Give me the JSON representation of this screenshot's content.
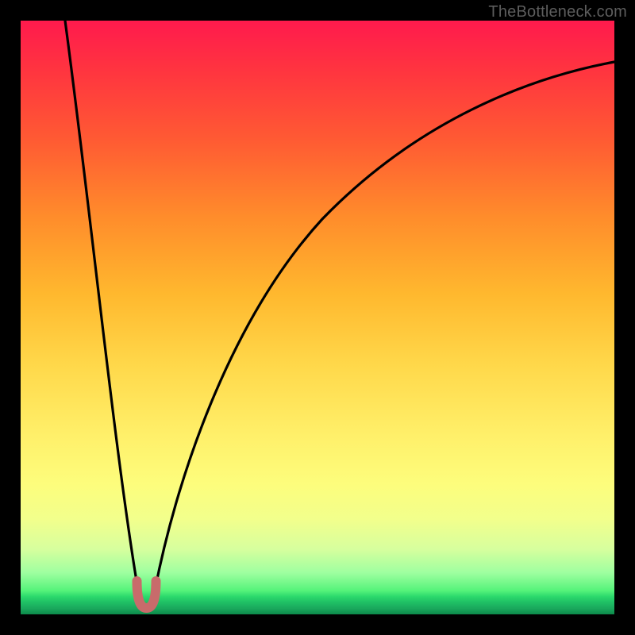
{
  "watermark": "TheBottleneck.com",
  "colors": {
    "page_bg": "#000000",
    "curve": "#000000",
    "marker_fill": "#c86b6b",
    "marker_stroke": "#b85e5e"
  },
  "chart_data": {
    "type": "line",
    "title": "",
    "xlabel": "",
    "ylabel": "",
    "xlim": [
      0,
      100
    ],
    "ylim": [
      0,
      100
    ],
    "grid": false,
    "legend": false,
    "series": [
      {
        "name": "left-branch",
        "x": [
          7.5,
          9,
          10.5,
          12,
          13.5,
          15,
          16.5,
          18,
          19.2,
          19.8
        ],
        "y": [
          100,
          89,
          78,
          66,
          54,
          42,
          30,
          18,
          8,
          4
        ]
      },
      {
        "name": "right-branch",
        "x": [
          22.6,
          23.5,
          25,
          27,
          30,
          34,
          38,
          43,
          49,
          56,
          64,
          73,
          83,
          92,
          100
        ],
        "y": [
          4,
          8,
          16,
          26,
          37,
          47,
          55,
          62,
          68,
          74,
          79,
          83,
          87,
          90.5,
          93
        ]
      }
    ],
    "markers": [
      {
        "name": "min-left",
        "x": 19.8,
        "y": 4
      },
      {
        "name": "min-mid",
        "x": 21.2,
        "y": 1.3
      },
      {
        "name": "min-right",
        "x": 22.6,
        "y": 4
      }
    ]
  }
}
